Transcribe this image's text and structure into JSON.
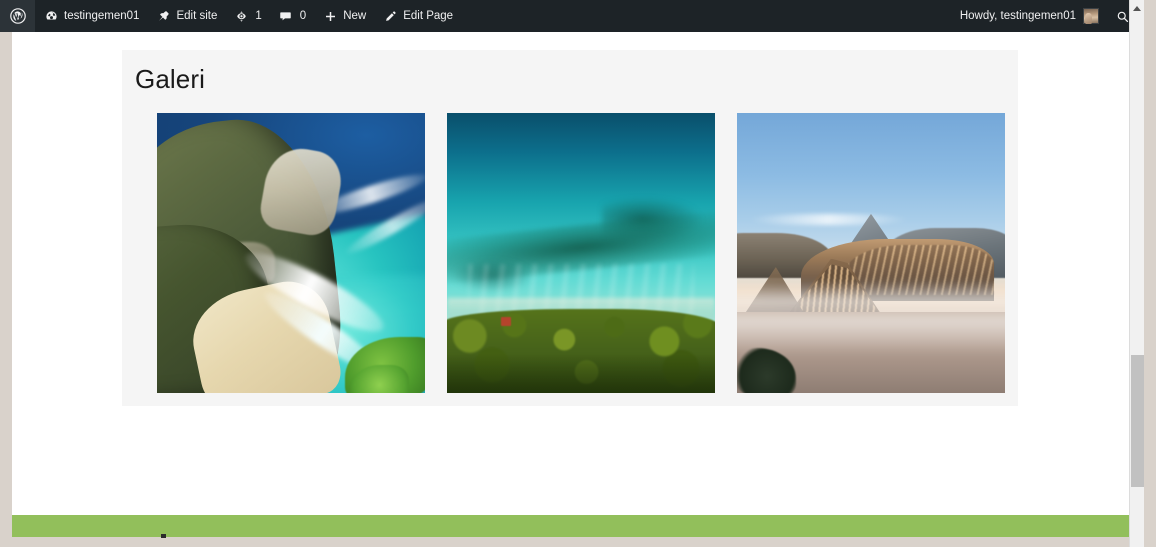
{
  "adminbar": {
    "logo_icon": "wordpress-logo-icon",
    "site": {
      "label": "testingemen01",
      "icon": "dashboard-icon"
    },
    "edit_site": {
      "label": "Edit site",
      "icon": "pushpin-icon"
    },
    "updates": {
      "count": "1",
      "icon": "updates-icon"
    },
    "comments": {
      "count": "0",
      "icon": "comment-bubble-icon"
    },
    "new": {
      "label": "New",
      "icon": "plus-icon"
    },
    "edit_page": {
      "label": "Edit Page",
      "icon": "pencil-icon"
    },
    "howdy": {
      "label": "Howdy, testingemen01",
      "avatar_icon": "user-avatar"
    },
    "search": {
      "icon": "search-icon"
    },
    "background_color": "#1d2327",
    "text_color": "#f0f0f1"
  },
  "content": {
    "page_title": "Galeri",
    "card_background": "#f5f5f5"
  },
  "gallery": {
    "items": [
      {
        "name": "kelingking-beach-cliff",
        "alt": "Aerial view of Kelingking Beach cliff with turquoise sea and white sand"
      },
      {
        "name": "aerial-turquoise-reef-jungle",
        "alt": "Aerial view of turquoise reef water meeting dense green jungle coastline"
      },
      {
        "name": "mount-bromo-sunrise",
        "alt": "Mount Bromo volcanic caldera at sunrise with mist and Semeru in the distance"
      }
    ]
  },
  "footer": {
    "band_color": "#92bf5b"
  },
  "scrollbar": {
    "up_arrow_icon": "scroll-up-arrow-icon",
    "thumb_color": "#c1c1c1",
    "track_color": "#f1f1f1"
  },
  "page_margin_color": "#d9d2cb"
}
